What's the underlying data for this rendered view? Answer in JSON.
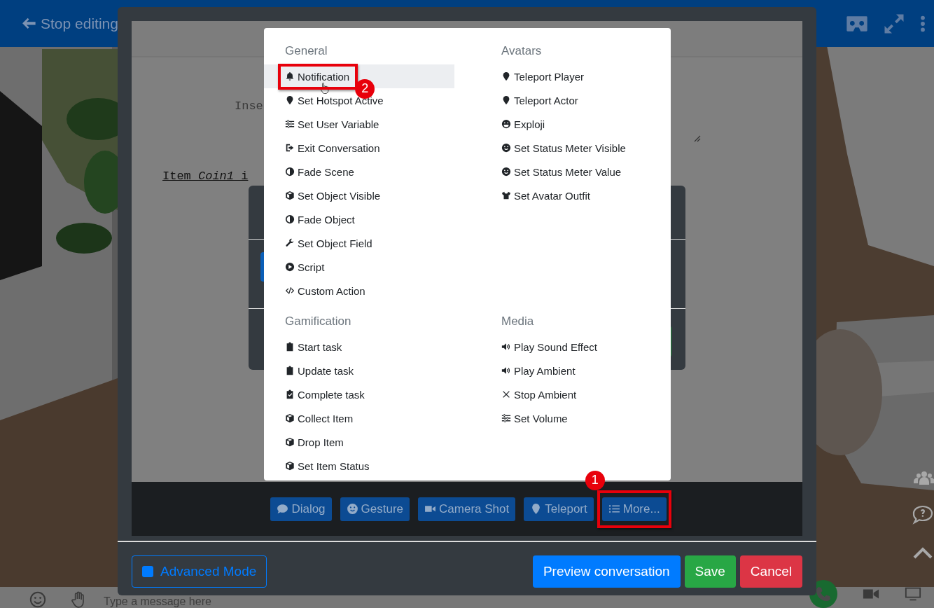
{
  "top_bar": {
    "back_label": "Stop editing"
  },
  "editor": {
    "hint_text": "Inse",
    "line_text": "Item *Coin1* i"
  },
  "action_menu": {
    "sections": [
      {
        "title": "General",
        "items": [
          {
            "label": "Notification",
            "kind": "bell",
            "selected": true,
            "annotation": "2"
          },
          {
            "label": "Set Hotspot Active",
            "kind": "marker",
            "selected": false
          },
          {
            "label": "Set User Variable",
            "kind": "sliders",
            "selected": false
          },
          {
            "label": "Exit Conversation",
            "kind": "exit",
            "selected": false
          },
          {
            "label": "Fade Scene",
            "kind": "half",
            "selected": false
          },
          {
            "label": "Set Object Visible",
            "kind": "cube",
            "selected": false
          },
          {
            "label": "Fade Object",
            "kind": "half",
            "selected": false
          },
          {
            "label": "Set Object Field",
            "kind": "wrench",
            "selected": false
          },
          {
            "label": "Script",
            "kind": "play",
            "selected": false
          },
          {
            "label": "Custom Action",
            "kind": "code",
            "selected": false
          }
        ]
      },
      {
        "title": "Avatars",
        "items": [
          {
            "label": "Teleport Player",
            "kind": "marker",
            "selected": false
          },
          {
            "label": "Teleport Actor",
            "kind": "marker",
            "selected": false
          },
          {
            "label": "Exploji",
            "kind": "grin",
            "selected": false
          },
          {
            "label": "Set Status Meter Visible",
            "kind": "smile",
            "selected": false
          },
          {
            "label": "Set Status Meter Value",
            "kind": "smile",
            "selected": false
          },
          {
            "label": "Set Avatar Outfit",
            "kind": "tshirt",
            "selected": false
          }
        ]
      },
      {
        "title": "Gamification",
        "items": [
          {
            "label": "Start task",
            "kind": "clipboard",
            "selected": false
          },
          {
            "label": "Update task",
            "kind": "clipboard",
            "selected": false
          },
          {
            "label": "Complete task",
            "kind": "clipcheck",
            "selected": false
          },
          {
            "label": "Collect Item",
            "kind": "cube",
            "selected": false
          },
          {
            "label": "Drop Item",
            "kind": "cube",
            "selected": false
          },
          {
            "label": "Set Item Status",
            "kind": "cube",
            "selected": false
          }
        ]
      },
      {
        "title": "Media",
        "items": [
          {
            "label": "Play Sound Effect",
            "kind": "volume",
            "selected": false
          },
          {
            "label": "Play Ambient",
            "kind": "volume",
            "selected": false
          },
          {
            "label": "Stop Ambient",
            "kind": "times",
            "selected": false
          },
          {
            "label": "Set Volume",
            "kind": "sliders",
            "selected": false
          }
        ]
      }
    ]
  },
  "toolbar": {
    "buttons": [
      {
        "label": "Dialog",
        "kind": "comment"
      },
      {
        "label": "Gesture",
        "kind": "smile"
      },
      {
        "label": "Camera Shot",
        "kind": "video"
      },
      {
        "label": "Teleport",
        "kind": "marker"
      },
      {
        "label": "More...",
        "kind": "list",
        "annotation": "1"
      }
    ]
  },
  "footer": {
    "advanced_label": "Advanced Mode",
    "buttons": [
      {
        "label": "Preview conversation",
        "kind": "primary"
      },
      {
        "label": "Save",
        "kind": "success"
      },
      {
        "label": "Cancel",
        "kind": "danger"
      }
    ]
  },
  "chat_bar": {
    "placeholder": "Type a message here"
  }
}
